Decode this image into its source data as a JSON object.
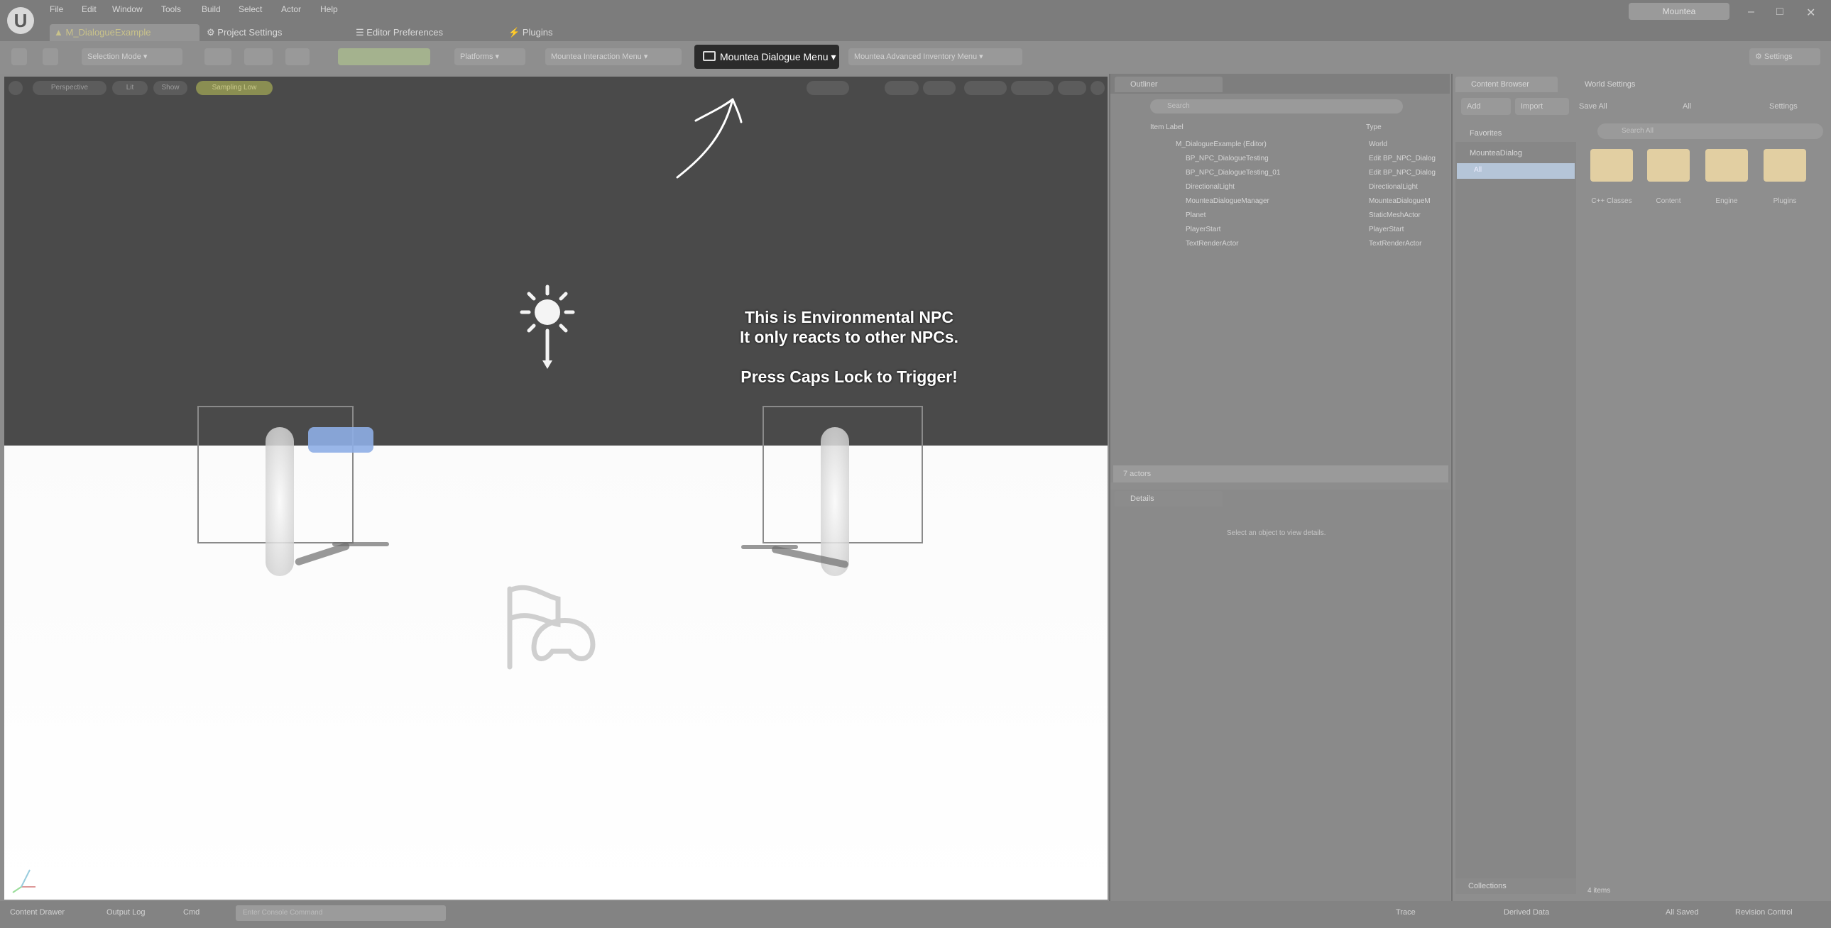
{
  "app": {
    "logo_text": "U",
    "menus": [
      "File",
      "Edit",
      "Window",
      "Tools",
      "Build",
      "Select",
      "Actor",
      "Help"
    ],
    "user_badge": "Mountea",
    "window_controls": {
      "minimize": "–",
      "maximize": "□",
      "close": "✕"
    }
  },
  "tabs": [
    {
      "label": "M_DialogueExample",
      "icon": "level-icon"
    },
    {
      "label": "Project Settings",
      "icon": "settings-icon"
    },
    {
      "label": "Editor Preferences",
      "icon": "preferences-icon"
    },
    {
      "label": "Plugins",
      "icon": "plugin-icon"
    }
  ],
  "toolbar": {
    "selection_mode": "Selection Mode",
    "platforms": "Platforms",
    "interaction_menu": "Mountea Interaction Menu",
    "dialogue_menu": "Mountea Dialogue Menu",
    "inventory_menu": "Mountea Advanced Inventory Menu",
    "settings": "Settings"
  },
  "viewport": {
    "chips": [
      "Perspective",
      "Lit",
      "Show",
      "Sampling Low"
    ],
    "npc_text_line1": "This is Environmental NPC",
    "npc_text_line2": "It only reacts to other NPCs.",
    "npc_text_line3": "Press Caps Lock to Trigger!"
  },
  "outliner": {
    "tab_label": "Outliner",
    "search_placeholder": "Search",
    "col_label": "Item Label",
    "col_type": "Type",
    "rows": [
      {
        "label": "M_DialogueExample (Editor)",
        "type": "World"
      },
      {
        "label": "BP_NPC_DialogueTesting",
        "type": "Edit BP_NPC_Dialog"
      },
      {
        "label": "BP_NPC_DialogueTesting_01",
        "type": "Edit BP_NPC_Dialog"
      },
      {
        "label": "DirectionalLight",
        "type": "DirectionalLight"
      },
      {
        "label": "MounteaDialogueManager",
        "type": "MounteaDialogueM"
      },
      {
        "label": "Planet",
        "type": "StaticMeshActor"
      },
      {
        "label": "PlayerStart",
        "type": "PlayerStart"
      },
      {
        "label": "TextRenderActor",
        "type": "TextRenderActor"
      }
    ],
    "footer": "7 actors"
  },
  "details": {
    "tab_label": "Details",
    "empty_text": "Select an object to view details."
  },
  "content_browser": {
    "tab_label": "Content Browser",
    "world_settings_tab": "World Settings",
    "add_label": "Add",
    "import_label": "Import",
    "save_all_label": "Save All",
    "path_all": "All",
    "settings_label": "Settings",
    "search_placeholder": "Search All",
    "favorites_label": "Favorites",
    "project_label": "MounteaDialog",
    "selected_folder": "All",
    "folders": [
      "C++ Classes",
      "Content",
      "Engine",
      "Plugins"
    ],
    "collections_label": "Collections",
    "item_count": "4 items"
  },
  "statusbar": {
    "content_drawer": "Content Drawer",
    "output_log": "Output Log",
    "cmd": "Cmd",
    "console_placeholder": "Enter Console Command",
    "trace": "Trace",
    "derived_data": "Derived Data",
    "all_saved": "All Saved",
    "revision_control": "Revision Control"
  },
  "colors": {
    "accent_dialogue_menu_bg": "#2b2b2b",
    "sky": "#4a4a4a",
    "floor": "#ffffff",
    "folder": "#e2cfa2"
  }
}
